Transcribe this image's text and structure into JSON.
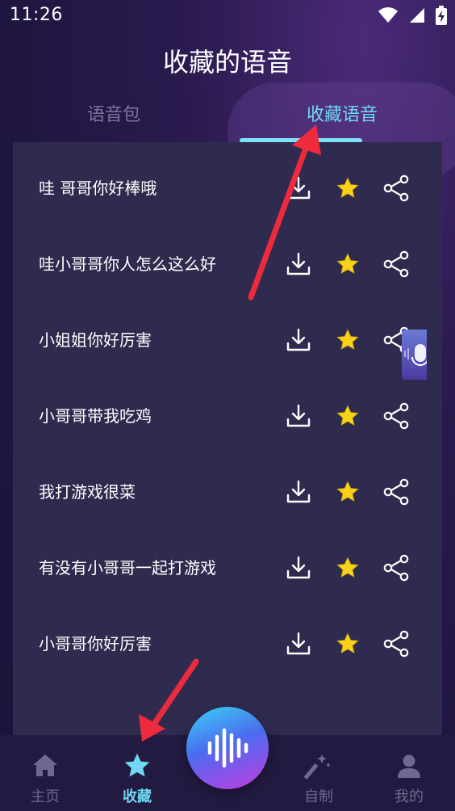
{
  "status_bar": {
    "time": "11:26",
    "icons": [
      "wifi-icon",
      "cellular-signal-icon",
      "battery-charging-icon"
    ]
  },
  "header": {
    "title": "收藏的语音"
  },
  "tabs": [
    {
      "label": "语音包",
      "active": false
    },
    {
      "label": "收藏语音",
      "active": true
    }
  ],
  "voice_list": [
    {
      "label": "哇 哥哥你好棒哦"
    },
    {
      "label": "哇小哥哥你人怎么这么好"
    },
    {
      "label": "小姐姐你好厉害"
    },
    {
      "label": "小哥哥带我吃鸡"
    },
    {
      "label": "我打游戏很菜"
    },
    {
      "label": "有没有小哥哥一起打游戏"
    },
    {
      "label": "小哥哥你好厉害"
    }
  ],
  "row_actions": [
    "download-icon",
    "star-icon",
    "share-icon"
  ],
  "bottom_nav": [
    {
      "label": "主页",
      "icon": "home-icon",
      "active": false
    },
    {
      "label": "收藏",
      "icon": "star-icon",
      "active": true
    },
    {
      "label": "自制",
      "icon": "magic-wand-icon",
      "active": false
    },
    {
      "label": "我的",
      "icon": "user-icon",
      "active": false
    }
  ],
  "center_button": {
    "icon": "sound-wave-icon"
  },
  "colors": {
    "accent": "#6fd9f3",
    "star": "#f7d21c",
    "panel": "#2f2b4f",
    "annotation_arrow": "#ee2b3c"
  }
}
